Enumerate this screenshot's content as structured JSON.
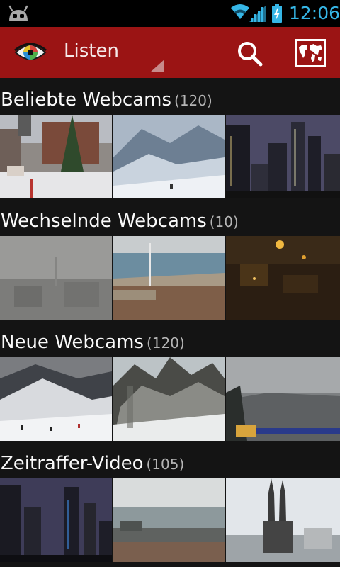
{
  "status_bar": {
    "time": "12:06",
    "accent_color": "#36b6e6",
    "icons": [
      "android-robot-icon",
      "wifi-icon",
      "signal-icon",
      "battery-charging-icon"
    ]
  },
  "action_bar": {
    "title": "Listen",
    "background_color": "#9b1414",
    "icons": [
      "app-eye-logo-icon",
      "search-icon",
      "world-map-icon"
    ]
  },
  "sections": [
    {
      "title": "Beliebte Webcams",
      "count": "(120)",
      "thumbnails": [
        "town-square-christmas-tree",
        "snowy-mountain-slope",
        "city-skyline-dusk"
      ]
    },
    {
      "title": "Wechselnde Webcams",
      "count": "(10)",
      "thumbnails": [
        "foggy-city-view",
        "beach-promenade",
        "night-town-lights"
      ]
    },
    {
      "title": "Neue Webcams",
      "count": "(120)",
      "thumbnails": [
        "ski-slope-people",
        "snowy-mountain-peaks",
        "cloudy-landscape-tv-logo"
      ]
    },
    {
      "title": "Zeitraffer-Video",
      "count": "(105)",
      "thumbnails": [
        "city-skyline-night",
        "harbour-coast",
        "cathedral-city-view"
      ]
    }
  ]
}
